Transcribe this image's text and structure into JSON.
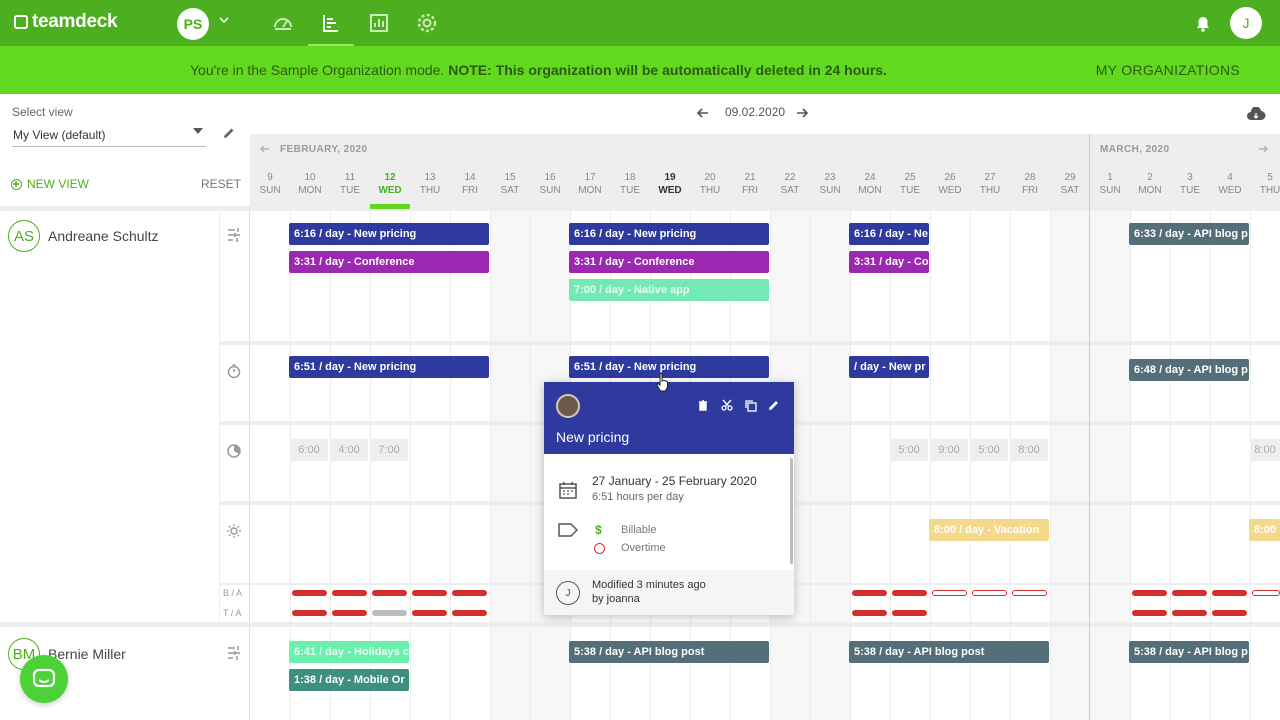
{
  "app": {
    "logo": "teamdeck",
    "org_initials": "PS",
    "user_initial": "J"
  },
  "nav": [
    {
      "name": "dashboard-icon"
    },
    {
      "name": "planner-icon",
      "active": true
    },
    {
      "name": "reports-icon"
    },
    {
      "name": "settings-icon"
    }
  ],
  "banner": {
    "text": "You're in the Sample Organization mode.",
    "note": "NOTE: This organization will be automatically deleted in 24 hours.",
    "my_organizations": "MY ORGANIZATIONS"
  },
  "left_panel": {
    "select_view_label": "Select view",
    "view_value": "My View (default)",
    "new_view": "NEW VIEW",
    "reset": "RESET"
  },
  "date_nav": {
    "current": "09.02.2020"
  },
  "months": {
    "first": "FEBRUARY, 2020",
    "second": "MARCH, 2020"
  },
  "days": [
    {
      "num": "9",
      "dow": "SUN"
    },
    {
      "num": "10",
      "dow": "MON"
    },
    {
      "num": "11",
      "dow": "TUE"
    },
    {
      "num": "12",
      "dow": "WED",
      "today": true
    },
    {
      "num": "13",
      "dow": "THU"
    },
    {
      "num": "14",
      "dow": "FRI"
    },
    {
      "num": "15",
      "dow": "SAT"
    },
    {
      "num": "16",
      "dow": "SUN"
    },
    {
      "num": "17",
      "dow": "MON"
    },
    {
      "num": "18",
      "dow": "TUE"
    },
    {
      "num": "19",
      "dow": "WED",
      "bold": true
    },
    {
      "num": "20",
      "dow": "THU"
    },
    {
      "num": "21",
      "dow": "FRI"
    },
    {
      "num": "22",
      "dow": "SAT"
    },
    {
      "num": "23",
      "dow": "SUN"
    },
    {
      "num": "24",
      "dow": "MON"
    },
    {
      "num": "25",
      "dow": "TUE"
    },
    {
      "num": "26",
      "dow": "WED"
    },
    {
      "num": "27",
      "dow": "THU"
    },
    {
      "num": "28",
      "dow": "FRI"
    },
    {
      "num": "29",
      "dow": "SAT"
    },
    {
      "num": "1",
      "dow": "SUN"
    },
    {
      "num": "2",
      "dow": "MON"
    },
    {
      "num": "3",
      "dow": "TUE"
    },
    {
      "num": "4",
      "dow": "WED"
    },
    {
      "num": "5",
      "dow": "THU"
    }
  ],
  "people": [
    {
      "initials": "AS",
      "name": "Andreane Schultz"
    },
    {
      "initials": "BM",
      "name": "Bernie Miller"
    }
  ],
  "row_labels": {
    "ba": "B / A",
    "ta": "T / A"
  },
  "bars": {
    "a1": "6:16 / day - New pricing",
    "a2": "6:16 / day - New pricing",
    "a3": "6:16 / day - Ne",
    "a4": "6:33 / day - API blog p",
    "b1": "3:31 / day - Conference",
    "b2": "3:31 / day - Conference",
    "b3": "3:31 / day - Co",
    "c1": "7:00 / day - Native app",
    "d1": "6:51 / day - New pricing",
    "d2": "6:51 / day - New pricing",
    "d3": "/ day - New pr",
    "d4": "6:48 / day - API blog p",
    "v1": "8:00 / day - Vacation",
    "v2": "8:00",
    "e1": "6:41 / day - Holidays c",
    "e2": "5:38 / day - API blog post",
    "e3": "5:38 / day - API blog post",
    "e4": "5:38 / day - API blog p",
    "f1": "1:38 / day - Mobile Or"
  },
  "hours": {
    "h1": "6:00",
    "h2": "4:00",
    "h3": "7:00",
    "h4": "5:00",
    "h5": "9:00",
    "h6": "5:00",
    "h7": "8:00",
    "h8": "8:00"
  },
  "popup": {
    "title": "New pricing",
    "dates": "27 January - 25 February 2020",
    "hours": "6:51 hours per day",
    "billable": "Billable",
    "dollar": "$",
    "overtime": "Overtime",
    "modified": "Modified 3 minutes ago",
    "by": "by joanna",
    "avatar_initial": "J"
  },
  "colors": {
    "brand": "#4caf1f",
    "banner": "#62d91f",
    "navy": "#2e3a9e",
    "purple": "#9c27b0",
    "slate": "#546e7a"
  }
}
